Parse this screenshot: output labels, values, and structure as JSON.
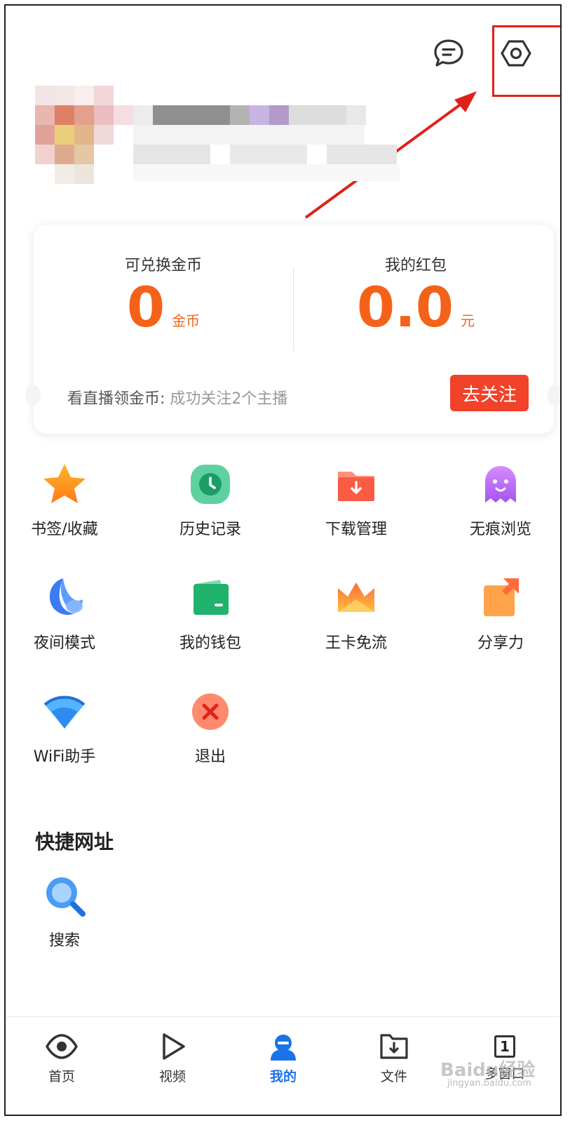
{
  "header": {
    "message_icon": "message-icon",
    "settings_icon": "settings-hex-icon"
  },
  "rewards": {
    "coins_label": "可兑换金币",
    "coins_value": "0",
    "coins_unit": "金币",
    "hongbao_label": "我的红包",
    "hongbao_value": "0.0",
    "hongbao_unit": "元",
    "tip_prefix": "看直播领金币:",
    "tip_rest": "成功关注2个主播",
    "follow_button": "去关注"
  },
  "grid": [
    {
      "label": "书签/收藏",
      "icon": "star-icon"
    },
    {
      "label": "历史记录",
      "icon": "clock-icon"
    },
    {
      "label": "下载管理",
      "icon": "download-folder-icon"
    },
    {
      "label": "无痕浏览",
      "icon": "ghost-icon"
    },
    {
      "label": "夜间模式",
      "icon": "moon-icon"
    },
    {
      "label": "我的钱包",
      "icon": "wallet-icon"
    },
    {
      "label": "王卡免流",
      "icon": "crown-icon"
    },
    {
      "label": "分享力",
      "icon": "share-icon"
    },
    {
      "label": "WiFi助手",
      "icon": "wifi-icon"
    },
    {
      "label": "退出",
      "icon": "close-circle-icon"
    }
  ],
  "shortcuts": {
    "title": "快捷网址",
    "items": [
      {
        "label": "搜索",
        "icon": "search-icon"
      }
    ]
  },
  "nav": [
    {
      "label": "首页",
      "icon": "eye-icon"
    },
    {
      "label": "视频",
      "icon": "play-icon"
    },
    {
      "label": "我的",
      "icon": "user-icon",
      "active": true
    },
    {
      "label": "文件",
      "icon": "file-download-icon"
    },
    {
      "label": "多窗口",
      "icon": "window-count-icon",
      "count": "1"
    }
  ],
  "watermark": {
    "text": "Baidu经验",
    "url": "jingyan.baidu.com"
  },
  "colors": {
    "accent": "#f46219",
    "button": "#f0432a",
    "active_nav": "#1a73e8",
    "highlight": "#e0201a"
  }
}
